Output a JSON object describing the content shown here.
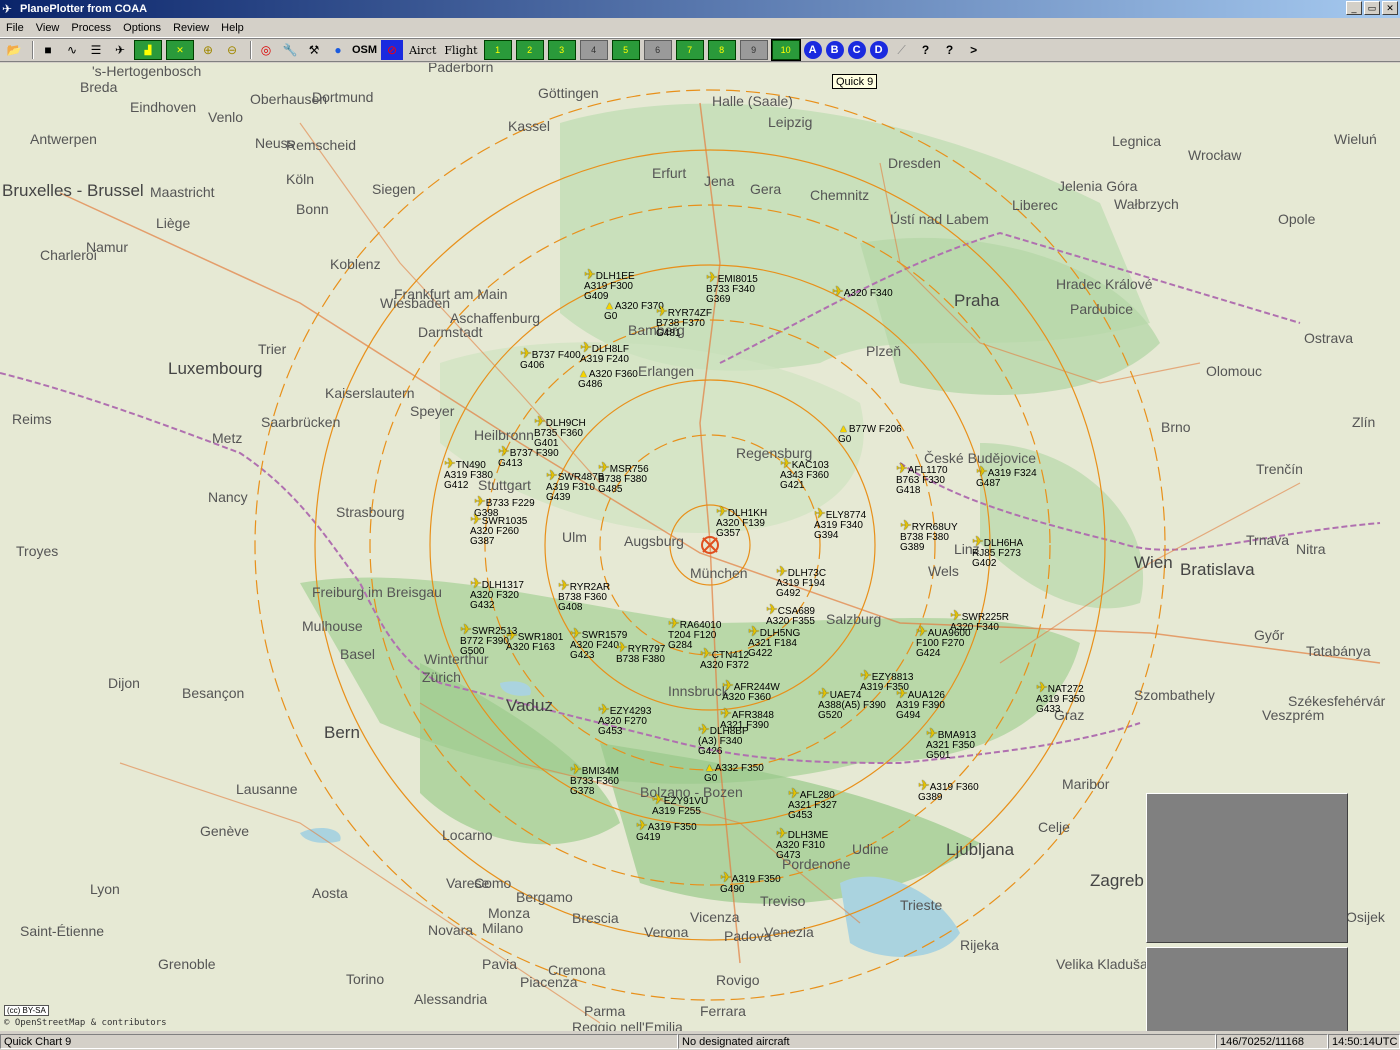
{
  "window": {
    "title": "PlanePlotter from COAA",
    "min": "_",
    "max": "▭",
    "close": "✕"
  },
  "menu": [
    "File",
    "View",
    "Process",
    "Options",
    "Review",
    "Help"
  ],
  "toolbar": {
    "aircraft_label": "Airct",
    "flight_label": "Flight",
    "osm_label": "OSM",
    "quick_charts": [
      "1",
      "2",
      "3",
      "4",
      "5",
      "6",
      "7",
      "8",
      "9",
      "10"
    ],
    "letters": [
      "A",
      "B",
      "C",
      "D"
    ],
    "help": "?",
    "help_query": "?",
    "next": ">"
  },
  "tooltip": "Quick 9",
  "map": {
    "attribution_badge": "(cc) BY-SA",
    "attribution": "© OpenStreetMap & contributors",
    "cities": [
      "'s-Hertogenbosch",
      "Paderborn",
      "Breda",
      "Eindhoven",
      "Oberhausen",
      "Dortmund",
      "Göttingen",
      "Halle (Saale)",
      "Venlo",
      "Antwerpen",
      "Kassel",
      "Leipzig",
      "Neuss",
      "Remscheid",
      "Legnica",
      "Wieluń",
      "Dresden",
      "Wrocław",
      "Erfurt",
      "Köln",
      "Jena",
      "Gera",
      "Siegen",
      "Chemnitz",
      "Jelenia Góra",
      "Wałbrzych",
      "Bonn",
      "Ústí nad Labem",
      "Liberec",
      "Opole",
      "Namur",
      "Liège",
      "Charleroi",
      "Koblenz",
      "Frankfurt am Main",
      "Wiesbaden",
      "Praha",
      "Hradec Králové",
      "Aschaffenburg",
      "Darmstadt",
      "Pardubice",
      "Trier",
      "Luxembourg",
      "Bamberg",
      "Plzeň",
      "Ostrava",
      "Erlangen",
      "Kaiserslautern",
      "Olomouc",
      "Speyer",
      "Reims",
      "Saarbrücken",
      "Metz",
      "Heilbronn",
      "Brno",
      "České Budějovice",
      "Zlín",
      "Regensburg",
      "Nancy",
      "Stuttgart",
      "Trenčín",
      "Strasbourg",
      "Ulm",
      "Augsburg",
      "Linz",
      "Troyes",
      "Wels",
      "Trnava",
      "Nitra",
      "Wien",
      "Bratislava",
      "Freiburg im Breisgau",
      "Mulhouse",
      "Salzburg",
      "Basel",
      "Winterthur",
      "Zürich",
      "Győr",
      "Tatabánya",
      "Dijon",
      "Besançon",
      "Vaduz",
      "Innsbruck",
      "Szombathely",
      "Székesfehérvár",
      "Veszprém",
      "Bern",
      "Graz",
      "Lausanne",
      "Maribor",
      "Bolzano - Bozen",
      "Genève",
      "Locarno",
      "Celje",
      "Udine",
      "Ljubljana",
      "Varese",
      "Como",
      "Bergamo",
      "Pordenone",
      "Aosta",
      "Zagreb",
      "Monza",
      "Brescia",
      "Treviso",
      "Trieste",
      "Milano",
      "Novara",
      "Vicenza",
      "Padova",
      "Venezia",
      "Saint-Étienne",
      "Verona",
      "Osijek",
      "Rijeka",
      "Grenoble",
      "Pavia",
      "Cremona",
      "Velika Kladuša",
      "Torino",
      "Rovigo",
      "Alessandria",
      "Piacenza",
      "Parma",
      "Ferrara",
      "Reggio nell'Emilia",
      "Bruxelles - Brussel",
      "Maastricht",
      "München",
      "Lyon"
    ],
    "aircraft": [
      {
        "callsign": "DLH1EE",
        "type_alt": "A319 F300",
        "gs": "G409"
      },
      {
        "callsign": "EMI8015",
        "type_alt": "B733 F340",
        "gs": "G369"
      },
      {
        "callsign": "",
        "type_alt": "A320 F340",
        "gs": ""
      },
      {
        "callsign": "",
        "type_alt": "A320 F370",
        "gs": "G0"
      },
      {
        "callsign": "RYR74ZF",
        "type_alt": "B738 F370",
        "gs": "G481"
      },
      {
        "callsign": "DLH8LF",
        "type_alt": "A319 F240",
        "gs": ""
      },
      {
        "callsign": "",
        "type_alt": "B737 F400",
        "gs": "G406"
      },
      {
        "callsign": "",
        "type_alt": "A320 F360",
        "gs": "G486"
      },
      {
        "callsign": "DLH9CH",
        "type_alt": "B735 F360",
        "gs": "G401"
      },
      {
        "callsign": "",
        "type_alt": "B737 F390",
        "gs": "G413"
      },
      {
        "callsign": "B77W",
        "type_alt": "F206",
        "gs": "G0"
      },
      {
        "callsign": "AFL1170",
        "type_alt": "B763 F330",
        "gs": "G418"
      },
      {
        "callsign": "",
        "type_alt": "A319 F324",
        "gs": "G487"
      },
      {
        "callsign": "TN490",
        "type_alt": "A319 F380",
        "gs": "G412"
      },
      {
        "callsign": "MSR756",
        "type_alt": "B738 F380",
        "gs": "G485"
      },
      {
        "callsign": "KAC103",
        "type_alt": "A343 F360",
        "gs": "G421"
      },
      {
        "callsign": "SWR487B",
        "type_alt": "A319 F310",
        "gs": "G439"
      },
      {
        "callsign": "",
        "type_alt": "B733 F229",
        "gs": "G398"
      },
      {
        "callsign": "DLH1KH",
        "type_alt": "A320 F139",
        "gs": "G357"
      },
      {
        "callsign": "ELY8774",
        "type_alt": "A319 F340",
        "gs": "G394"
      },
      {
        "callsign": "RYR68UY",
        "type_alt": "B738 F380",
        "gs": "G389"
      },
      {
        "callsign": "DLH6HA",
        "type_alt": "RJ85 F273",
        "gs": "G402"
      },
      {
        "callsign": "SWR1035",
        "type_alt": "A320 F260",
        "gs": "G387"
      },
      {
        "callsign": "DLH1317",
        "type_alt": "A320 F320",
        "gs": "G432"
      },
      {
        "callsign": "RYR2AR",
        "type_alt": "B738 F360",
        "gs": "G408"
      },
      {
        "callsign": "DLH73C",
        "type_alt": "A319 F194",
        "gs": "G492"
      },
      {
        "callsign": "CSA689",
        "type_alt": "A320 F355",
        "gs": ""
      },
      {
        "callsign": "SWR225R",
        "type_alt": "A320 F340",
        "gs": ""
      },
      {
        "callsign": "AUA9600",
        "type_alt": "F100 F270",
        "gs": "G424"
      },
      {
        "callsign": "SWR1801",
        "type_alt": "A320 F163",
        "gs": ""
      },
      {
        "callsign": "SWR1579",
        "type_alt": "A320 F240",
        "gs": "G423"
      },
      {
        "callsign": "RA64010",
        "type_alt": "T204 F120",
        "gs": "G284"
      },
      {
        "callsign": "DLH5NG",
        "type_alt": "A321 F184",
        "gs": "G422"
      },
      {
        "callsign": "EZY8813",
        "type_alt": "A319 F350",
        "gs": ""
      },
      {
        "callsign": "UAE74",
        "type_alt": "A388(A5) F390",
        "gs": "G520"
      },
      {
        "callsign": "AUA126",
        "type_alt": "A319 F390",
        "gs": "G494"
      },
      {
        "callsign": "NAT272",
        "type_alt": "A319 F350",
        "gs": "G433"
      },
      {
        "callsign": "SWR2513",
        "type_alt": "B772 F390",
        "gs": "G500"
      },
      {
        "callsign": "RYR797",
        "type_alt": "B738 F380",
        "gs": ""
      },
      {
        "callsign": "CTN412",
        "type_alt": "A320 F372",
        "gs": ""
      },
      {
        "callsign": "AFR244W",
        "type_alt": "A320 F360",
        "gs": ""
      },
      {
        "callsign": "AFR3848",
        "type_alt": "A321 F390",
        "gs": ""
      },
      {
        "callsign": "EZY4293",
        "type_alt": "A320 F270",
        "gs": "G453"
      },
      {
        "callsign": "BMA913",
        "type_alt": "A321 F350",
        "gs": "G501"
      },
      {
        "callsign": "DLH8BP",
        "type_alt": "(A3) F340",
        "gs": "G426"
      },
      {
        "callsign": "",
        "type_alt": "A332 F350",
        "gs": "G0"
      },
      {
        "callsign": "BMI34M",
        "type_alt": "B733 F360",
        "gs": "G378"
      },
      {
        "callsign": "",
        "type_alt": "A319 F360",
        "gs": "G389"
      },
      {
        "callsign": "AFL280",
        "type_alt": "A321 F327",
        "gs": "G453"
      },
      {
        "callsign": "EZY91VU",
        "type_alt": "A319 F255",
        "gs": ""
      },
      {
        "callsign": "",
        "type_alt": "A319 F350",
        "gs": "G419"
      },
      {
        "callsign": "DLH3ME",
        "type_alt": "A320 F310",
        "gs": "G473"
      },
      {
        "callsign": "",
        "type_alt": "A319 F350",
        "gs": "G490"
      }
    ]
  },
  "status": {
    "chart": "Quick Chart 9",
    "designated": "No designated aircraft",
    "counts": "146/70252/11168",
    "time": "14:50:14UTC"
  },
  "colors": {
    "ring": "#e8901a",
    "accent_green": "#2a9a3a",
    "title_blue": "#0a246a",
    "aircraft": "#e6c300"
  }
}
